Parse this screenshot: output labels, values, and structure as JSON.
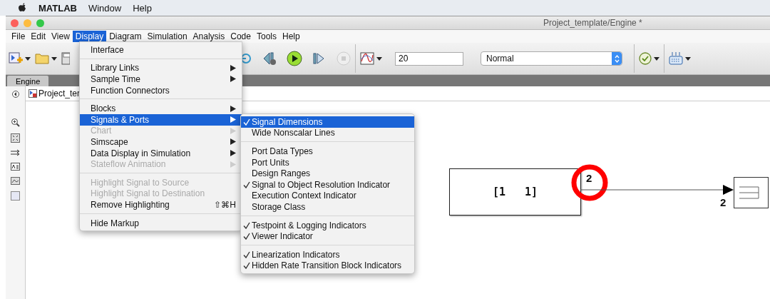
{
  "mac_menu": {
    "items": [
      {
        "label": "MATLAB",
        "kind": "app"
      },
      {
        "label": "Window",
        "kind": "menu"
      },
      {
        "label": "Help",
        "kind": "menu"
      }
    ]
  },
  "window": {
    "title": "Project_template/Engine *"
  },
  "menubar": [
    {
      "label": "File",
      "selected": false
    },
    {
      "label": "Edit",
      "selected": false
    },
    {
      "label": "View",
      "selected": false
    },
    {
      "label": "Display",
      "selected": true
    },
    {
      "label": "Diagram",
      "selected": false
    },
    {
      "label": "Simulation",
      "selected": false
    },
    {
      "label": "Analysis",
      "selected": false
    },
    {
      "label": "Code",
      "selected": false
    },
    {
      "label": "Tools",
      "selected": false
    },
    {
      "label": "Help",
      "selected": false
    }
  ],
  "toolbar": {
    "stop_time": "20",
    "sim_mode": "Normal"
  },
  "tabs": [
    {
      "label": "Engine",
      "selected": true
    }
  ],
  "breadcrumb": "Project_ter",
  "display_menu": [
    {
      "kind": "item",
      "label": "Interface",
      "disabled": false,
      "submenu": false,
      "selected": false
    },
    {
      "kind": "separator"
    },
    {
      "kind": "item",
      "label": "Library Links",
      "disabled": false,
      "submenu": true,
      "selected": false
    },
    {
      "kind": "item",
      "label": "Sample Time",
      "disabled": false,
      "submenu": true,
      "selected": false
    },
    {
      "kind": "item",
      "label": "Function Connectors",
      "disabled": false,
      "submenu": false,
      "selected": false
    },
    {
      "kind": "separator"
    },
    {
      "kind": "item",
      "label": "Blocks",
      "disabled": false,
      "submenu": true,
      "selected": false
    },
    {
      "kind": "item",
      "label": "Signals & Ports",
      "disabled": false,
      "submenu": true,
      "selected": true
    },
    {
      "kind": "item",
      "label": "Chart",
      "disabled": true,
      "submenu": true,
      "selected": false
    },
    {
      "kind": "item",
      "label": "Simscape",
      "disabled": false,
      "submenu": true,
      "selected": false
    },
    {
      "kind": "item",
      "label": "Data Display in Simulation",
      "disabled": false,
      "submenu": true,
      "selected": false
    },
    {
      "kind": "item",
      "label": "Stateflow Animation",
      "disabled": true,
      "submenu": true,
      "selected": false
    },
    {
      "kind": "separator"
    },
    {
      "kind": "item",
      "label": "Highlight Signal to Source",
      "disabled": true,
      "submenu": false,
      "selected": false
    },
    {
      "kind": "item",
      "label": "Highlight Signal to Destination",
      "disabled": true,
      "submenu": false,
      "selected": false
    },
    {
      "kind": "item",
      "label": "Remove Highlighting",
      "disabled": false,
      "submenu": false,
      "selected": false,
      "shortcut": "⇧⌘H"
    },
    {
      "kind": "separator"
    },
    {
      "kind": "item",
      "label": "Hide Markup",
      "disabled": false,
      "submenu": false,
      "selected": false
    }
  ],
  "signals_submenu": [
    {
      "kind": "item",
      "label": "Signal Dimensions",
      "checked": true,
      "selected": true
    },
    {
      "kind": "item",
      "label": "Wide Nonscalar Lines",
      "checked": false,
      "selected": false
    },
    {
      "kind": "separator"
    },
    {
      "kind": "item",
      "label": "Port Data Types",
      "checked": false,
      "selected": false
    },
    {
      "kind": "item",
      "label": "Port Units",
      "checked": false,
      "selected": false
    },
    {
      "kind": "item",
      "label": "Design Ranges",
      "checked": false,
      "selected": false
    },
    {
      "kind": "item",
      "label": "Signal to Object Resolution Indicator",
      "checked": true,
      "selected": false
    },
    {
      "kind": "item",
      "label": "Execution Context Indicator",
      "checked": false,
      "selected": false
    },
    {
      "kind": "item",
      "label": "Storage Class",
      "checked": false,
      "selected": false
    },
    {
      "kind": "separator"
    },
    {
      "kind": "item",
      "label": "Testpoint & Logging Indicators",
      "checked": true,
      "selected": false
    },
    {
      "kind": "item",
      "label": "Viewer Indicator",
      "checked": true,
      "selected": false
    },
    {
      "kind": "separator"
    },
    {
      "kind": "item",
      "label": "Linearization Indicators",
      "checked": true,
      "selected": false
    },
    {
      "kind": "item",
      "label": "Hidden Rate Transition Block Indicators",
      "checked": true,
      "selected": false
    }
  ],
  "diagram": {
    "block_label": "[1   1]",
    "output_dimension": "2",
    "input_dimension": "2"
  }
}
